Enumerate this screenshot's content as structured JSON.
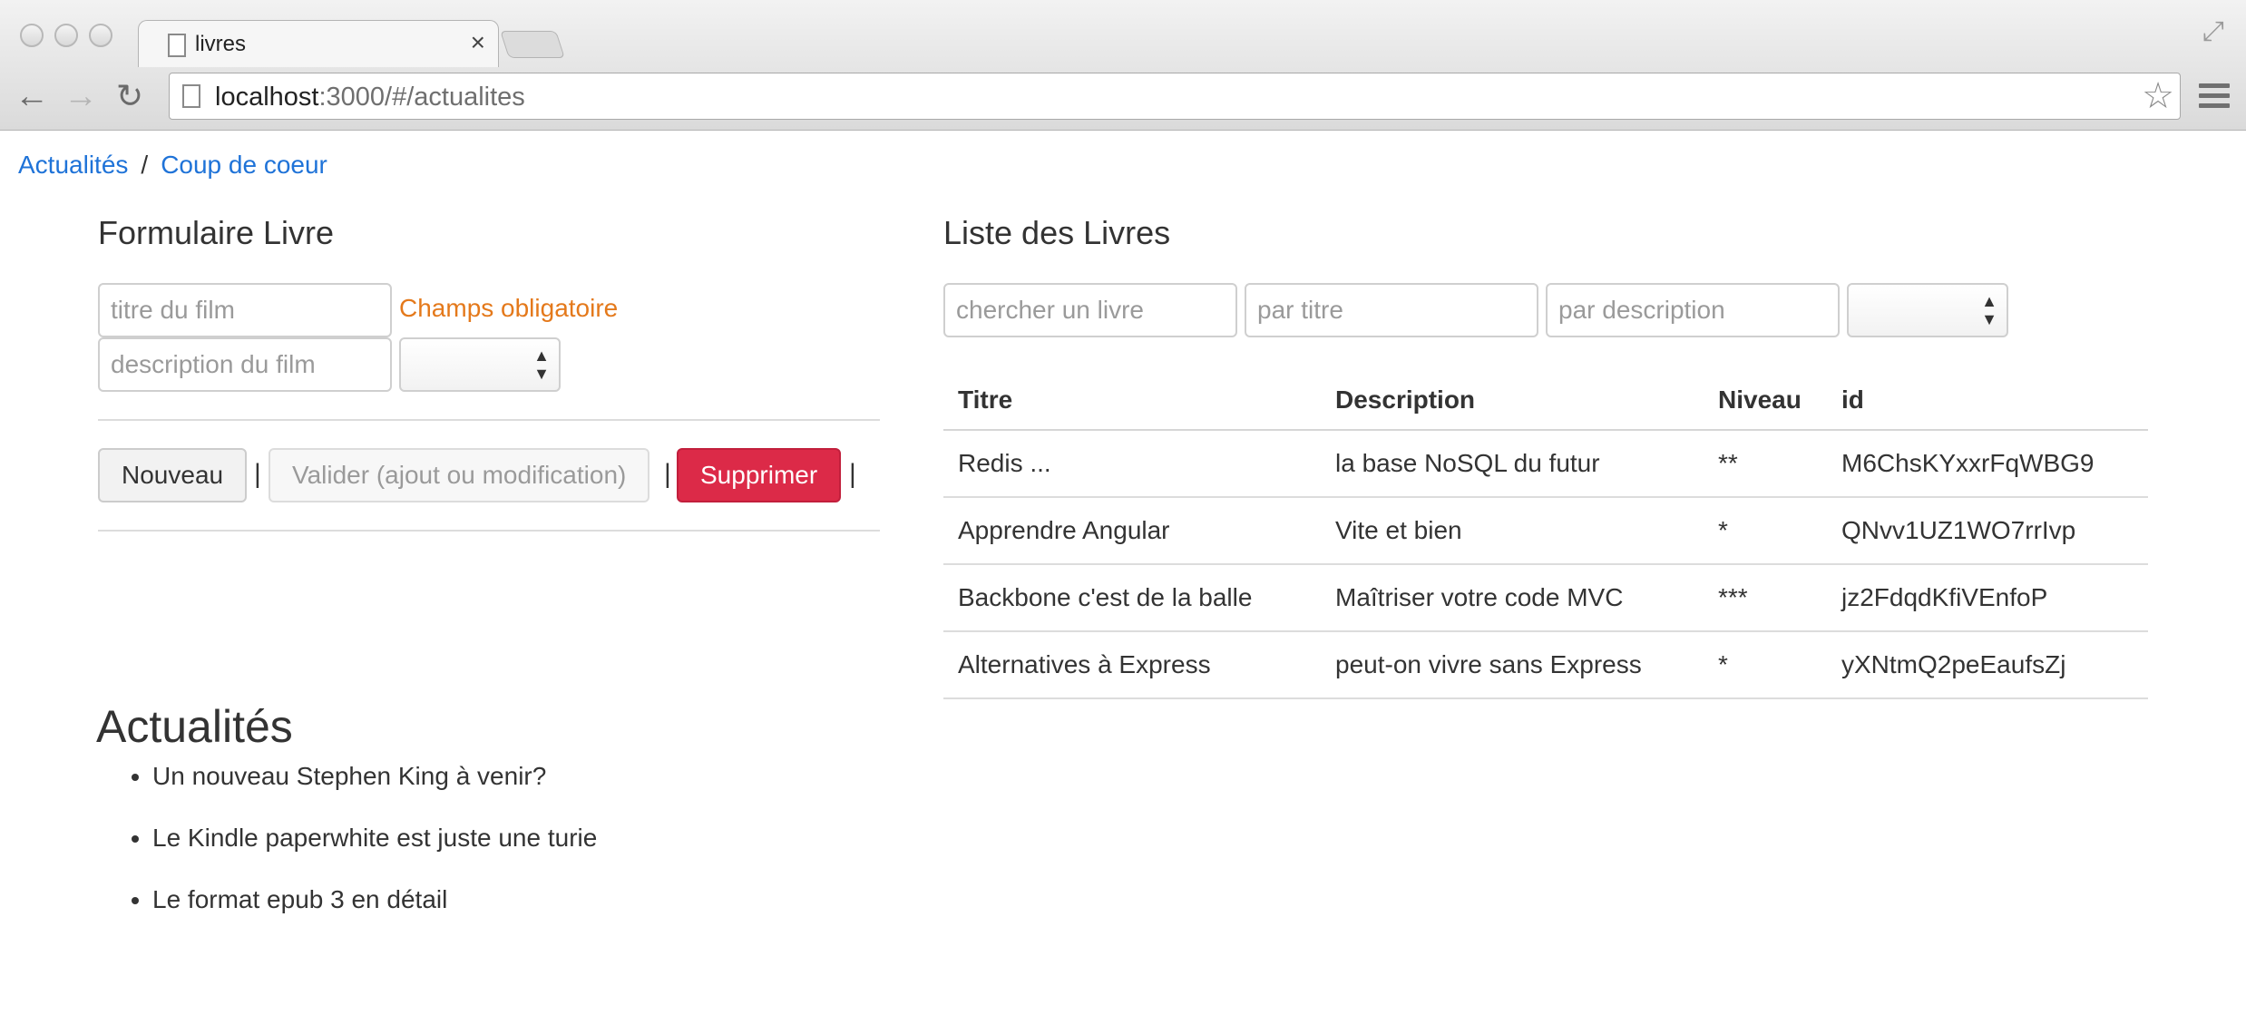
{
  "browser": {
    "tab_title": "livres",
    "tab_close": "×",
    "url_host": "localhost",
    "url_rest": ":3000/#/actualites"
  },
  "breadcrumb": {
    "items": [
      "Actualités",
      "Coup de coeur"
    ],
    "separator": "/"
  },
  "form": {
    "title": "Formulaire Livre",
    "title_placeholder": "titre du film",
    "required_label": "Champs obligatoire",
    "description_placeholder": "description du film",
    "buttons": {
      "new": "Nouveau",
      "validate": "Valider (ajout ou modification)",
      "delete": "Supprimer"
    },
    "pipe": "|"
  },
  "list": {
    "title": "Liste des Livres",
    "filters": {
      "search_placeholder": "chercher un livre",
      "title_placeholder": "par titre",
      "description_placeholder": "par description"
    },
    "columns": [
      "Titre",
      "Description",
      "Niveau",
      "id"
    ],
    "rows": [
      [
        "Redis ...",
        "la base NoSQL du futur",
        "**",
        "M6ChsKYxxrFqWBG9"
      ],
      [
        "Apprendre Angular",
        "Vite et bien",
        "*",
        "QNvv1UZ1WO7rrIvp"
      ],
      [
        "Backbone c'est de la balle",
        "Maîtriser votre code MVC",
        "***",
        "jz2FdqdKfiVEnfoP"
      ],
      [
        "Alternatives à Express",
        "peut-on vivre sans Express",
        "*",
        "yXNtmQ2peEaufsZj"
      ]
    ]
  },
  "news": {
    "title": "Actualités",
    "items": [
      "Un nouveau Stephen King à venir?",
      "Le Kindle paperwhite est juste une turie",
      "Le format epub 3 en détail"
    ]
  },
  "colors": {
    "link": "#1f73d8",
    "required": "#e4791b",
    "danger": "#dc2a48"
  }
}
